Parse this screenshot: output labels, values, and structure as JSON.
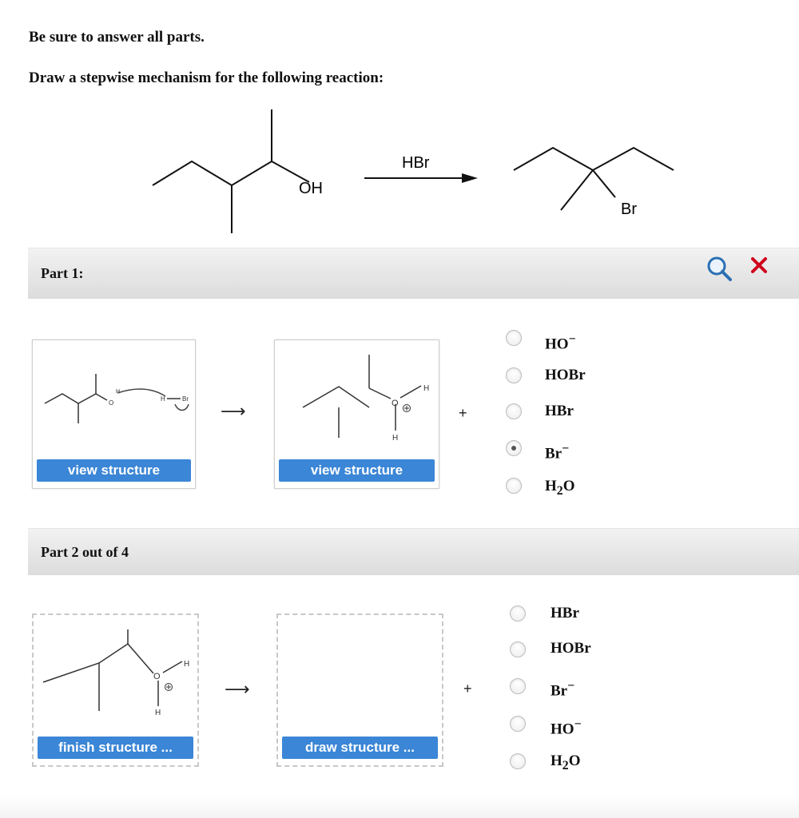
{
  "instructions": {
    "line1": "Be sure to answer all parts.",
    "line2": "Draw a stepwise mechanism for the following reaction:"
  },
  "reaction": {
    "reactant_label": "OH",
    "reagent_label": "HBr",
    "product_label": "Br"
  },
  "part1": {
    "title": "Part 1:",
    "box1": {
      "button": "view structure",
      "labels": {
        "h": "H",
        "hbr": "H",
        "br": "Br",
        "o": "O"
      }
    },
    "box2": {
      "button": "view structure",
      "labels": {
        "o": "O",
        "h_top": "H",
        "h_bottom": "H",
        "charge": "⊕"
      }
    },
    "arrow": "⟶",
    "plus": "+",
    "options": [
      {
        "label": "HO",
        "suffix": "−",
        "selected": false
      },
      {
        "label": "HOBr",
        "suffix": "",
        "selected": false
      },
      {
        "label": "HBr",
        "suffix": "",
        "selected": false
      },
      {
        "label": "Br",
        "suffix": "−",
        "selected": true
      },
      {
        "label": "H",
        "sub": "2",
        "rest": "O",
        "selected": false
      }
    ]
  },
  "part2": {
    "title": "Part 2 out of 4",
    "box1": {
      "button": "finish structure ...",
      "labels": {
        "o": "O",
        "h_top": "H",
        "h_bottom": "H",
        "charge": "⊕"
      }
    },
    "box2": {
      "button": "draw structure ..."
    },
    "arrow": "⟶",
    "plus": "+",
    "options": [
      {
        "label": "HBr",
        "suffix": "",
        "selected": false
      },
      {
        "label": "HOBr",
        "suffix": "",
        "selected": false
      },
      {
        "label": "Br",
        "suffix": "−",
        "selected": false
      },
      {
        "label": "HO",
        "suffix": "−",
        "selected": false
      },
      {
        "label": "H",
        "sub": "2",
        "rest": "O",
        "selected": false
      }
    ]
  },
  "icons": {
    "zoom": "magnifier-icon",
    "close": "close-icon",
    "close_color": "#d0021b",
    "zoom_color": "#2a6fb3"
  }
}
